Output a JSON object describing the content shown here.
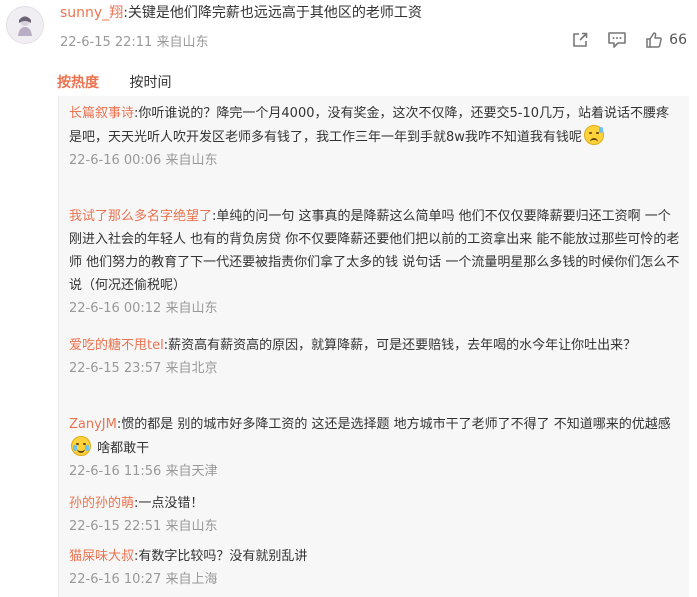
{
  "comment": {
    "username": "sunny_翔",
    "text": ":关键是他们降完薪也远远高于其他区的老师工资",
    "time": "22-6-15 22:11",
    "location": "来自山东",
    "like_count": "66",
    "icons": [
      "share-icon",
      "comment-icon",
      "like-icon"
    ]
  },
  "tabs": [
    {
      "label": "按热度",
      "active": true
    },
    {
      "label": "按时间",
      "active": false
    }
  ],
  "replies": [
    {
      "username": "长篇叙事诗",
      "text_before": ":你听谁说的？降完一个月4000，没有奖金，这次不仅降，还要交5-10几万，站着说话不腰疼是吧，天天光听人吹开发区老师多有钱了，我工作三年一年到手就8w我咋不知道我有钱呢",
      "emoji": "sad-emoji",
      "text_after": "",
      "time": "22-6-16 00:06",
      "location": "来自山东"
    },
    {
      "username": "我试了那么多名字绝望了",
      "text_before": ":单纯的问一句 这事真的是降薪这么简单吗 他们不仅仅要降薪要归还工资啊 一个刚进入社会的年轻人 也有的背负房贷 你不仅要降薪还要他们把以前的工资拿出来 能不能放过那些可怜的老师 他们努力的教育了下一代还要被指责你们拿了太多的钱 说句话 一个流量明星那么多钱的时候你们怎么不说（何况还偷税呢）",
      "emoji": "",
      "text_after": "",
      "time": "22-6-16 00:12",
      "location": "来自山东"
    },
    {
      "username": "爱吃的糖不甩tel",
      "text_before": ":薪资高有薪资高的原因，就算降薪，可是还要赔钱，去年喝的水今年让你吐出来？",
      "emoji": "",
      "text_after": "",
      "time": "22-6-15 23:57",
      "location": "来自北京"
    },
    {
      "username": "ZanyJM",
      "text_before": ":惯的都是 别的城市好多降工资的 这还是选择题  地方城市干了老师了不得了 不知道哪来的优越感",
      "emoji": "crying-emoji",
      "text_after": " 啥都敢干",
      "time": "22-6-16 11:56",
      "location": "来自天津"
    },
    {
      "username": "孙的孙的萌",
      "text_before": ":一点没错！",
      "emoji": "",
      "text_after": "",
      "time": "22-6-15 22:51",
      "location": "来自山东"
    },
    {
      "username": "猫屎味大叔",
      "text_before": ":有数字比较吗？没有就别乱讲",
      "emoji": "",
      "text_after": "",
      "time": "22-6-16 10:27",
      "location": "来自上海"
    }
  ],
  "colors": {
    "accent": "#eb7350",
    "meta": "#999999",
    "reply_bg": "#f7f7f7"
  }
}
